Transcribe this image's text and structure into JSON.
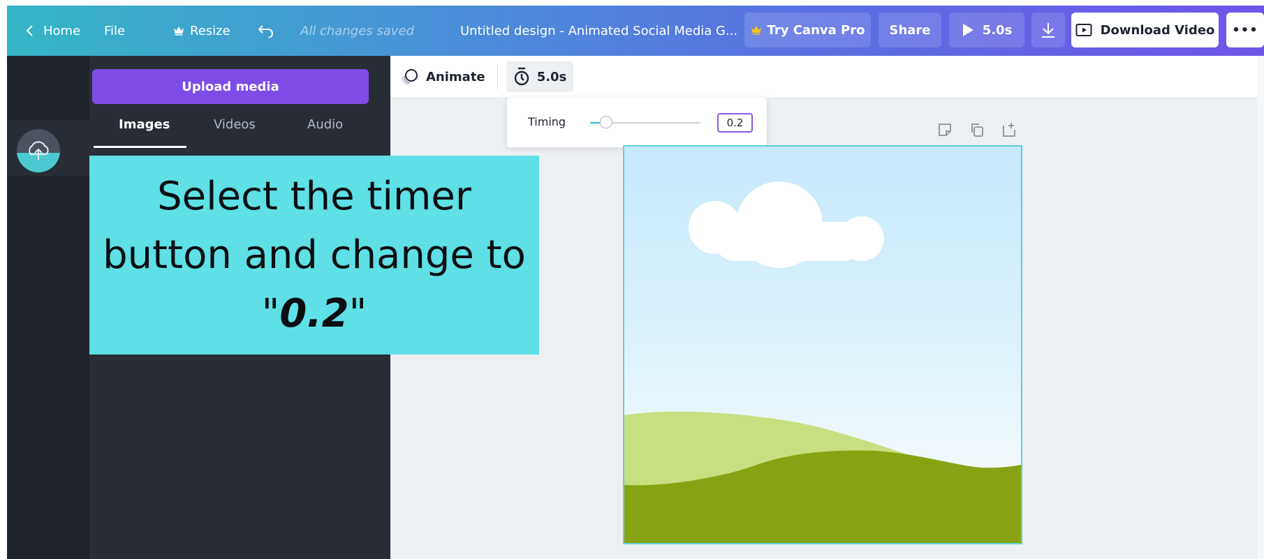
{
  "topbar": {
    "home_label": "Home",
    "file_label": "File",
    "resize_label": "Resize",
    "save_status": "All changes saved",
    "design_title": "Untitled design - Animated Social Media G...",
    "try_pro_label": "Try Canva Pro",
    "share_label": "Share",
    "play_duration": "5.0s",
    "download_video_label": "Download Video",
    "more_label": "•••"
  },
  "sidebar": {
    "upload_button": "Upload media",
    "tabs": [
      {
        "label": "Images",
        "active": true
      },
      {
        "label": "Videos",
        "active": false
      },
      {
        "label": "Audio",
        "active": false
      }
    ]
  },
  "editor_toolbar": {
    "animate_label": "Animate",
    "timer_label": "5.0s"
  },
  "timing_popover": {
    "label": "Timing",
    "value": "0.2",
    "slider_fraction": 0.09
  },
  "instruction": {
    "line1": "Select the timer",
    "line2": "button and change to",
    "quote_open": "\"",
    "value": "0.2",
    "quote_close": "\""
  },
  "icons": {
    "home": "chevron-left-icon",
    "resize": "crown-icon",
    "undo": "undo-icon",
    "pro": "crown-icon",
    "play": "play-icon",
    "download": "download-icon",
    "download_video": "video-icon",
    "animate": "animate-icon",
    "timer": "timer-icon",
    "upload": "cloud-upload-icon",
    "page_actions": [
      "add-note-icon",
      "duplicate-page-icon",
      "add-page-icon"
    ]
  },
  "colors": {
    "accent_purple": "#7d4be6",
    "topbar_start": "#34b5c6",
    "topbar_end": "#7055ea",
    "overlay_bg": "#5ee0e6",
    "pro_crown": "#f5c518",
    "slider_fill": "#2bbcd0",
    "hill_light": "#c7df80",
    "hill_dark": "#87a313"
  }
}
